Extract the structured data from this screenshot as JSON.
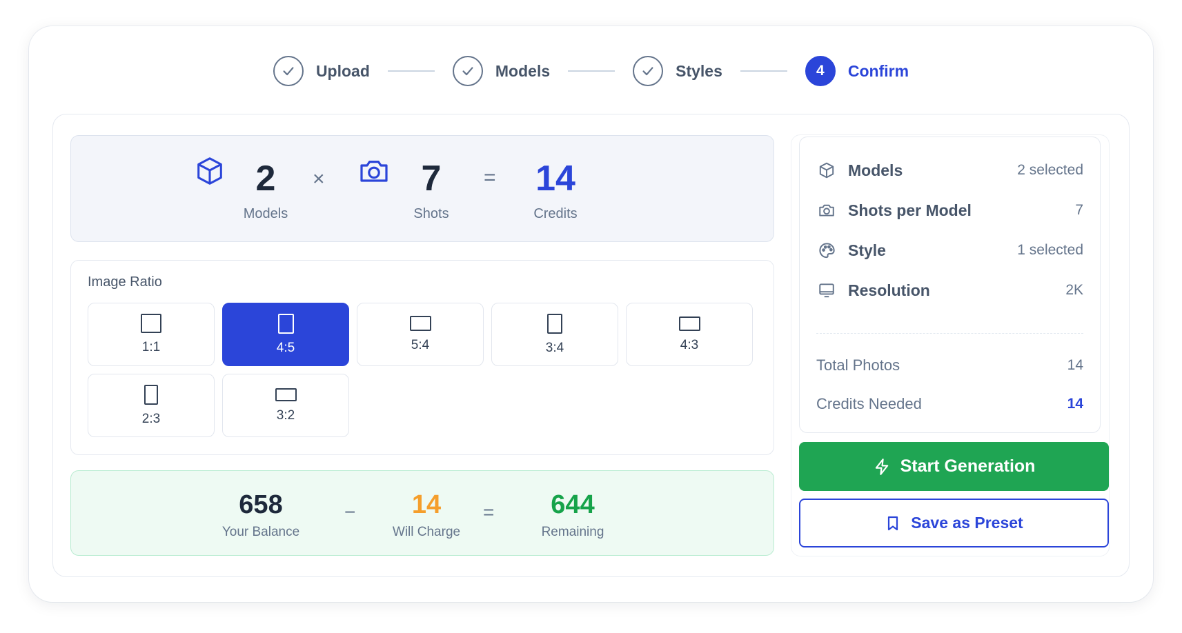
{
  "stepper": {
    "steps": [
      {
        "label": "Upload",
        "state": "done"
      },
      {
        "label": "Models",
        "state": "done"
      },
      {
        "label": "Styles",
        "state": "done"
      },
      {
        "label": "Confirm",
        "state": "active",
        "number": "4"
      }
    ]
  },
  "formula": {
    "models": {
      "value": "2",
      "label": "Models",
      "icon": "cube-icon"
    },
    "times": "×",
    "shots": {
      "value": "7",
      "label": "Shots",
      "icon": "camera-icon"
    },
    "equals": "=",
    "credits": {
      "value": "14",
      "label": "Credits"
    }
  },
  "ratio": {
    "title": "Image Ratio",
    "selected": "4:5",
    "options": [
      "1:1",
      "4:5",
      "5:4",
      "3:4",
      "4:3",
      "2:3",
      "3:2"
    ]
  },
  "balance": {
    "balance": {
      "value": "658",
      "label": "Your Balance"
    },
    "minus": "−",
    "charge": {
      "value": "14",
      "label": "Will Charge"
    },
    "equals": "=",
    "remaining": {
      "value": "644",
      "label": "Remaining"
    }
  },
  "summary": {
    "rows": [
      {
        "label": "Models",
        "value": "2 selected",
        "icon": "cube-icon"
      },
      {
        "label": "Shots per Model",
        "value": "7",
        "icon": "camera-icon"
      },
      {
        "label": "Style",
        "value": "1 selected",
        "icon": "palette-icon"
      },
      {
        "label": "Resolution",
        "value": "2K",
        "icon": "monitor-icon"
      }
    ],
    "total_photos": {
      "label": "Total Photos",
      "value": "14"
    },
    "credits_needed": {
      "label": "Credits Needed",
      "value": "14"
    }
  },
  "actions": {
    "start_label": "Start Generation",
    "preset_label": "Save as Preset"
  },
  "colors": {
    "accent": "#2b45d9",
    "success": "#1fa553",
    "warning": "#f59e2b",
    "remaining": "#16a34a"
  }
}
